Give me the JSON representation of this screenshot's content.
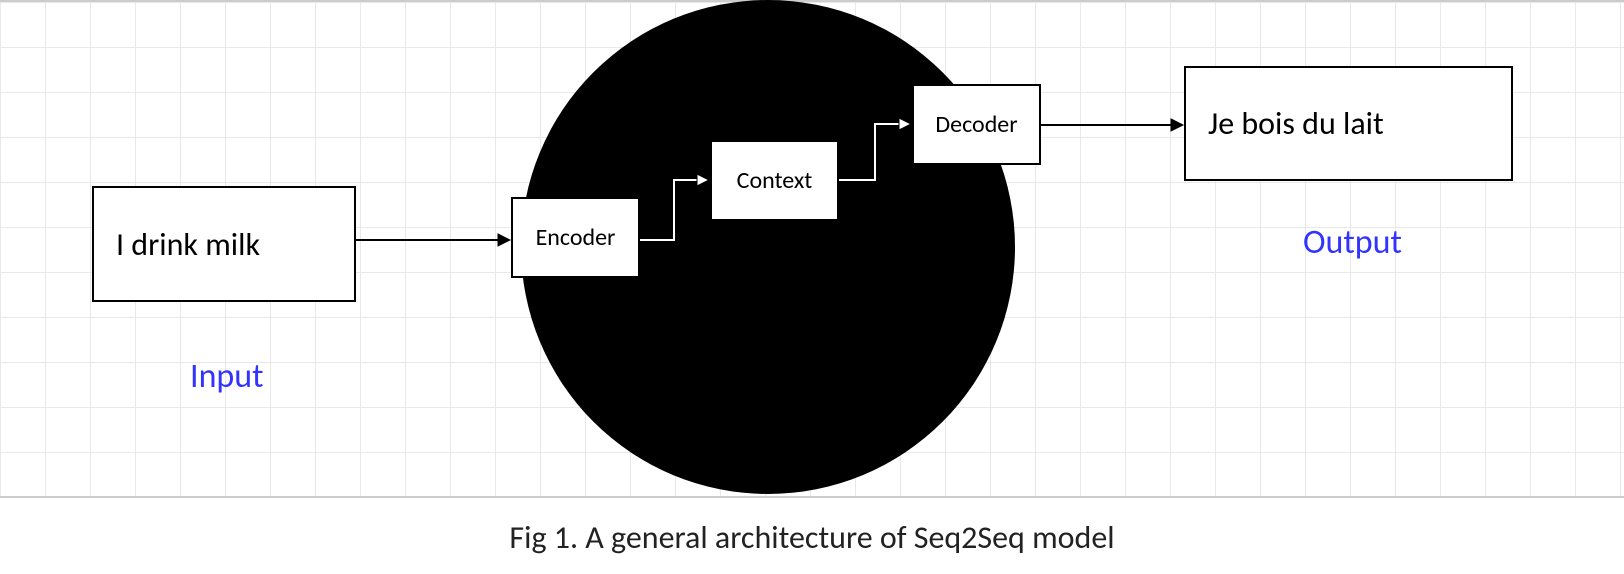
{
  "boxes": {
    "input": "I drink milk",
    "encoder": "Encoder",
    "context": "Context",
    "decoder": "Decoder",
    "output": "Je bois du lait"
  },
  "labels": {
    "input": "Input",
    "output": "Output"
  },
  "caption": "Fig 1. A general architecture of Seq2Seq model"
}
